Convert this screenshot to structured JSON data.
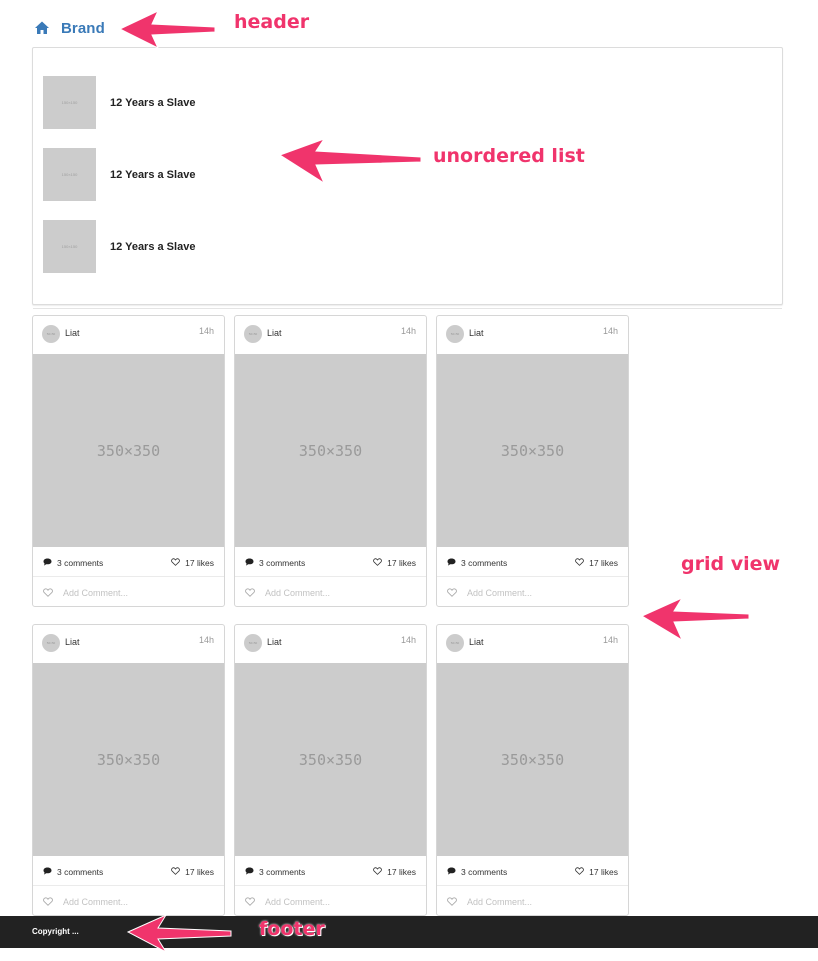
{
  "header": {
    "brand": "Brand",
    "icon": "home-icon",
    "color": "#3a7ab8"
  },
  "list": {
    "items": [
      {
        "thumb": "150×150",
        "title": "12 Years a Slave"
      },
      {
        "thumb": "150×150",
        "title": "12 Years a Slave"
      },
      {
        "thumb": "150×150",
        "title": "12 Years a Slave"
      }
    ]
  },
  "grid": {
    "cards": [
      {
        "user": "Liat",
        "avatar": "50×50",
        "time": "14h",
        "image": "350×350",
        "comments": "3 comments",
        "likes": "17 likes",
        "add_placeholder": "Add Comment..."
      },
      {
        "user": "Liat",
        "avatar": "50×50",
        "time": "14h",
        "image": "350×350",
        "comments": "3 comments",
        "likes": "17 likes",
        "add_placeholder": "Add Comment..."
      },
      {
        "user": "Liat",
        "avatar": "50×50",
        "time": "14h",
        "image": "350×350",
        "comments": "3 comments",
        "likes": "17 likes",
        "add_placeholder": "Add Comment..."
      },
      {
        "user": "Liat",
        "avatar": "50×50",
        "time": "14h",
        "image": "350×350",
        "comments": "3 comments",
        "likes": "17 likes",
        "add_placeholder": "Add Comment..."
      },
      {
        "user": "Liat",
        "avatar": "50×50",
        "time": "14h",
        "image": "350×350",
        "comments": "3 comments",
        "likes": "17 likes",
        "add_placeholder": "Add Comment..."
      },
      {
        "user": "Liat",
        "avatar": "50×50",
        "time": "14h",
        "image": "350×350",
        "comments": "3 comments",
        "likes": "17 likes",
        "add_placeholder": "Add Comment..."
      }
    ]
  },
  "footer": {
    "copyright": "Copyright ..."
  },
  "annotations": {
    "header": "header",
    "list": "unordered list",
    "grid": "grid view",
    "footer": "footer",
    "color": "#f0346c"
  }
}
